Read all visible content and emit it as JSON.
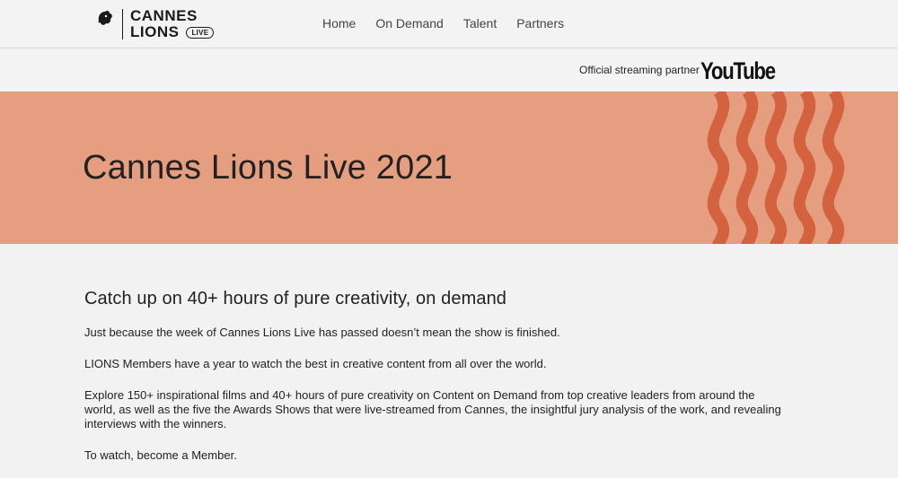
{
  "brand": {
    "line1": "CANNES",
    "line2": "LIONS",
    "badge": "LIVE"
  },
  "nav": {
    "items": [
      "Home",
      "On Demand",
      "Talent",
      "Partners"
    ]
  },
  "partner": {
    "label": "Official streaming partner",
    "name": "YouTube"
  },
  "hero": {
    "title": "Cannes Lions Live 2021",
    "bg_color": "#e59e80",
    "wave_color": "#d4623f"
  },
  "main": {
    "heading": "Catch up on 40+ hours of pure creativity, on demand",
    "paragraphs": [
      "Just because the week of Cannes Lions Live has passed doesn’t mean the show is finished.",
      "LIONS Members have a year to watch the best in creative content from all over the world.",
      "Explore 150+ inspirational films and 40+ hours of pure creativity on Content on Demand from top creative leaders from around the world, as well as the five the Awards Shows that were live-streamed from Cannes, the insightful jury analysis of the work, and revealing interviews with the winners.",
      "To watch, become a Member."
    ]
  }
}
